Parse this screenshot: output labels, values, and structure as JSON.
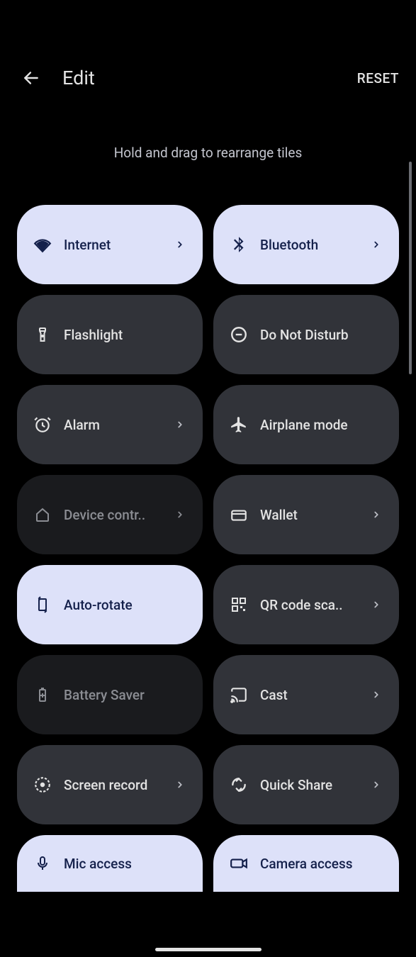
{
  "header": {
    "title": "Edit",
    "reset": "RESET"
  },
  "hint": "Hold and drag to rearrange tiles",
  "tiles": [
    {
      "id": "internet",
      "label": "Internet",
      "state": "active",
      "chevron": true
    },
    {
      "id": "bluetooth",
      "label": "Bluetooth",
      "state": "active",
      "chevron": true
    },
    {
      "id": "flashlight",
      "label": "Flashlight",
      "state": "inactive",
      "chevron": false
    },
    {
      "id": "dnd",
      "label": "Do Not Disturb",
      "state": "inactive",
      "chevron": false
    },
    {
      "id": "alarm",
      "label": "Alarm",
      "state": "inactive",
      "chevron": true
    },
    {
      "id": "airplane",
      "label": "Airplane mode",
      "state": "inactive",
      "chevron": false
    },
    {
      "id": "device-controls",
      "label": "Device contr..",
      "state": "disabled",
      "chevron": true
    },
    {
      "id": "wallet",
      "label": "Wallet",
      "state": "inactive",
      "chevron": true
    },
    {
      "id": "auto-rotate",
      "label": "Auto-rotate",
      "state": "active",
      "chevron": false
    },
    {
      "id": "qr-scan",
      "label": "QR code sca..",
      "state": "inactive",
      "chevron": true
    },
    {
      "id": "battery-saver",
      "label": "Battery Saver",
      "state": "disabled",
      "chevron": false
    },
    {
      "id": "cast",
      "label": "Cast",
      "state": "inactive",
      "chevron": true
    },
    {
      "id": "screen-record",
      "label": "Screen record",
      "state": "inactive",
      "chevron": true
    },
    {
      "id": "quick-share",
      "label": "Quick Share",
      "state": "inactive",
      "chevron": true
    },
    {
      "id": "mic-access",
      "label": "Mic access",
      "state": "active",
      "chevron": false
    },
    {
      "id": "camera-access",
      "label": "Camera access",
      "state": "active",
      "chevron": false
    }
  ],
  "icons": {
    "internet": "wifi-icon",
    "bluetooth": "bluetooth-icon",
    "flashlight": "flashlight-icon",
    "dnd": "dnd-icon",
    "alarm": "alarm-icon",
    "airplane": "airplane-icon",
    "device-controls": "home-icon",
    "wallet": "wallet-icon",
    "auto-rotate": "rotate-icon",
    "qr-scan": "qr-icon",
    "battery-saver": "battery-icon",
    "cast": "cast-icon",
    "screen-record": "record-icon",
    "quick-share": "share-icon",
    "mic-access": "mic-icon",
    "camera-access": "camera-icon"
  }
}
